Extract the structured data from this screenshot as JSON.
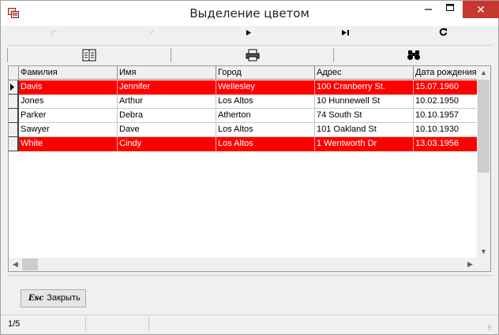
{
  "window": {
    "title": "Выделение цветом"
  },
  "nav": {
    "first_icon": "first-record-icon",
    "prev_icon": "prior-record-icon",
    "next_icon": "next-record-icon",
    "last_icon": "last-record-icon",
    "refresh_icon": "refresh-icon"
  },
  "toolbar": {
    "filter_icon": "filter-icon",
    "print_icon": "printer-icon",
    "search_icon": "binoculars-icon"
  },
  "grid": {
    "columns": [
      "Фамилия",
      "Имя",
      "Город",
      "Адрес",
      "Дата рождения"
    ],
    "rows": [
      {
        "cells": [
          "Davis",
          "Jennifer",
          "Wellesley",
          "100 Cranberry St.",
          "15.07.1960"
        ],
        "highlighted": true,
        "current": true
      },
      {
        "cells": [
          "Jones",
          "Arthur",
          "Los Altos",
          "10 Hunnewell St",
          "10.02.1950"
        ],
        "highlighted": false,
        "current": false
      },
      {
        "cells": [
          "Parker",
          "Debra",
          "Atherton",
          "74 South St",
          "10.10.1957"
        ],
        "highlighted": false,
        "current": false
      },
      {
        "cells": [
          "Sawyer",
          "Dave",
          "Los Altos",
          "101 Oakland St",
          "10.10.1930"
        ],
        "highlighted": false,
        "current": false
      },
      {
        "cells": [
          "White",
          "Cindy",
          "Los Altos",
          "1 Wentworth Dr",
          "13.03.1956"
        ],
        "highlighted": true,
        "current": false
      }
    ],
    "highlight_color": "#ff0000"
  },
  "buttons": {
    "close_hotkey": "Esc",
    "close_label": "Закрыть"
  },
  "status": {
    "record_position": "1/5"
  }
}
